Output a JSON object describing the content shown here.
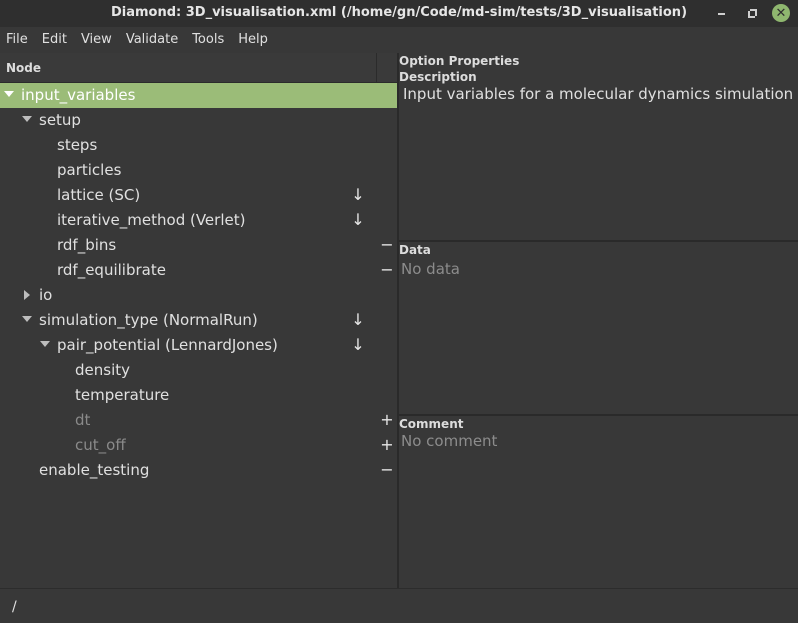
{
  "window": {
    "title": "Diamond: 3D_visualisation.xml (/home/gn/Code/md-sim/tests/3D_visualisation)",
    "buttons": [
      "minimize-icon",
      "maximize-icon",
      "close-icon"
    ],
    "close_glyph": "✕"
  },
  "menubar": {
    "items": [
      "File",
      "Edit",
      "View",
      "Validate",
      "Tools",
      "Help"
    ]
  },
  "tree": {
    "header": "Node",
    "rows": [
      {
        "label": "input_variables",
        "expander": "down",
        "action": "",
        "dim": false
      },
      {
        "label": "setup",
        "expander": "down",
        "action": "",
        "dim": false
      },
      {
        "label": "steps",
        "expander": "",
        "action": "",
        "dim": false
      },
      {
        "label": "particles",
        "expander": "",
        "action": "",
        "dim": false
      },
      {
        "label": "lattice (SC)",
        "expander": "",
        "action": "↓",
        "dim": false
      },
      {
        "label": "iterative_method (Verlet)",
        "expander": "",
        "action": "↓",
        "dim": false
      },
      {
        "label": "rdf_bins",
        "expander": "",
        "action": "−",
        "dim": false
      },
      {
        "label": "rdf_equilibrate",
        "expander": "",
        "action": "−",
        "dim": false
      },
      {
        "label": "io",
        "expander": "right",
        "action": "",
        "dim": false
      },
      {
        "label": "simulation_type (NormalRun)",
        "expander": "down",
        "action": "↓",
        "dim": false
      },
      {
        "label": "pair_potential (LennardJones)",
        "expander": "down",
        "action": "↓",
        "dim": false
      },
      {
        "label": "density",
        "expander": "",
        "action": "",
        "dim": false
      },
      {
        "label": "temperature",
        "expander": "",
        "action": "",
        "dim": false
      },
      {
        "label": "dt",
        "expander": "",
        "action": "+",
        "dim": true
      },
      {
        "label": "cut_off",
        "expander": "",
        "action": "+",
        "dim": true
      },
      {
        "label": "enable_testing",
        "expander": "",
        "action": "−",
        "dim": false
      }
    ]
  },
  "properties": {
    "title": "Option Properties",
    "description_heading": "Description",
    "description_text": "Input variables for a molecular dynamics simulation",
    "data_heading": "Data",
    "data_text": "No data",
    "comment_heading": "Comment",
    "comment_text": "No comment"
  },
  "statusbar": {
    "path": "/"
  },
  "colors": {
    "selection": "#9bbc78",
    "close_button": "#8fb76f",
    "background": "#383838"
  }
}
